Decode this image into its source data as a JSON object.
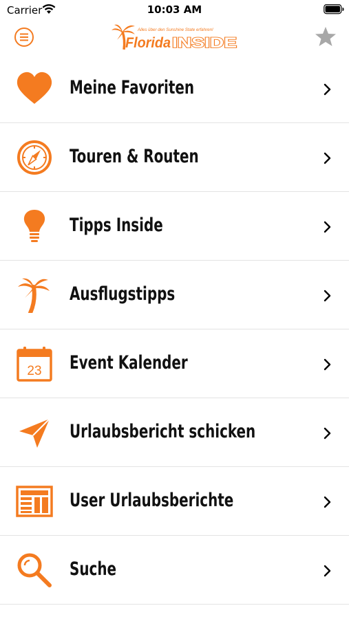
{
  "status_bar": {
    "carrier": "Carrier",
    "time": "10:03 AM"
  },
  "header": {
    "logo_tagline": "Alles über den Sunshine State erfahren!",
    "logo_text_a": "Florida",
    "logo_text_b": "INSIDE",
    "menu_icon": "hamburger-circle-icon",
    "favorites_icon": "star-icon"
  },
  "colors": {
    "accent": "#f47b20",
    "star": "#a8a8a8",
    "divider": "#e3e3e3"
  },
  "menu": {
    "items": [
      {
        "label": "Meine Favoriten",
        "icon": "heart-icon"
      },
      {
        "label": "Touren & Routen",
        "icon": "compass-icon"
      },
      {
        "label": "Tipps Inside",
        "icon": "lightbulb-icon"
      },
      {
        "label": "Ausflugstipps",
        "icon": "palm-tree-icon"
      },
      {
        "label": "Event Kalender",
        "icon": "calendar-icon",
        "icon_text": "23"
      },
      {
        "label": "Urlaubsbericht schicken",
        "icon": "paper-plane-icon"
      },
      {
        "label": "User Urlaubsberichte",
        "icon": "newspaper-icon"
      },
      {
        "label": "Suche",
        "icon": "magnifier-icon"
      }
    ]
  }
}
